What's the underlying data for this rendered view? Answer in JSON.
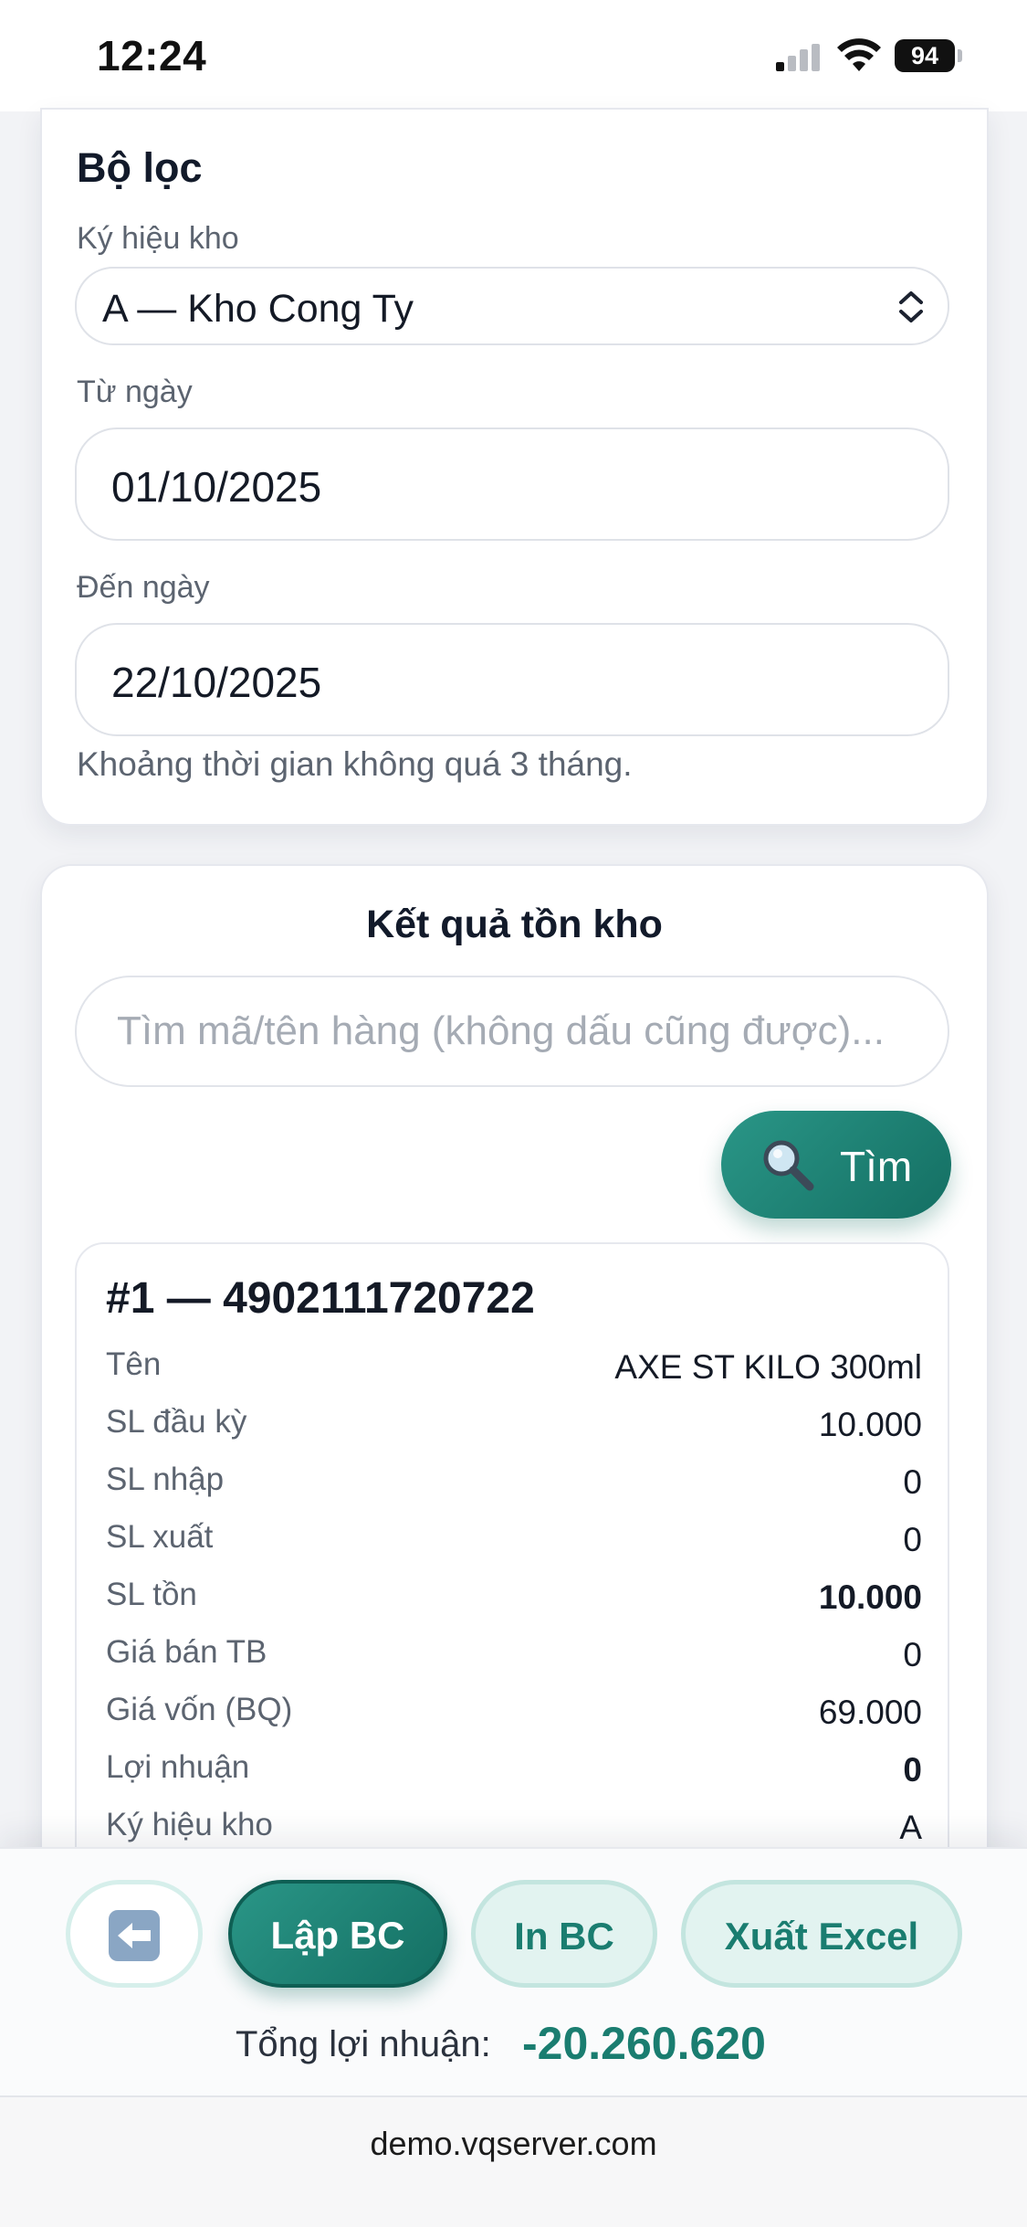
{
  "status_bar": {
    "time": "12:24",
    "battery": "94"
  },
  "filter": {
    "title": "Bộ lọc",
    "warehouse_label": "Ký hiệu kho",
    "warehouse_value": "A — Kho Cong Ty",
    "from_label": "Từ ngày",
    "from_value": "01/10/2025",
    "to_label": "Đến ngày",
    "to_value": "22/10/2025",
    "hint": "Khoảng thời gian không quá 3 tháng."
  },
  "results": {
    "title": "Kết quả tồn kho",
    "search_placeholder": "Tìm mã/tên hàng (không dấu cũng được)...",
    "search_button": "Tìm",
    "item": {
      "header": "#1 — 4902111720722",
      "rows": [
        {
          "label": "Tên",
          "value": "AXE ST KILO 300ml"
        },
        {
          "label": "SL đầu kỳ",
          "value": "10.000"
        },
        {
          "label": "SL nhập",
          "value": "0"
        },
        {
          "label": "SL xuất",
          "value": "0"
        },
        {
          "label": "SL tồn",
          "value": "10.000"
        },
        {
          "label": "Giá bán TB",
          "value": "0"
        },
        {
          "label": "Giá vốn (BQ)",
          "value": "69.000"
        },
        {
          "label": "Lợi nhuận",
          "value": "0"
        },
        {
          "label": "Ký hiệu kho",
          "value": "A"
        }
      ]
    }
  },
  "actions": {
    "back_icon": "back-arrow-icon",
    "lap_bc": "Lập BC",
    "in_bc": "In BC",
    "xuat_excel": "Xuất Excel",
    "total_label": "Tổng lợi nhuận:",
    "total_value": "-20.260.620"
  },
  "browser": {
    "url": "demo.vqserver.com"
  },
  "colors": {
    "accent": "#1a7d70",
    "accent_dark": "#146f63",
    "accent_light": "#e2f3f0"
  }
}
